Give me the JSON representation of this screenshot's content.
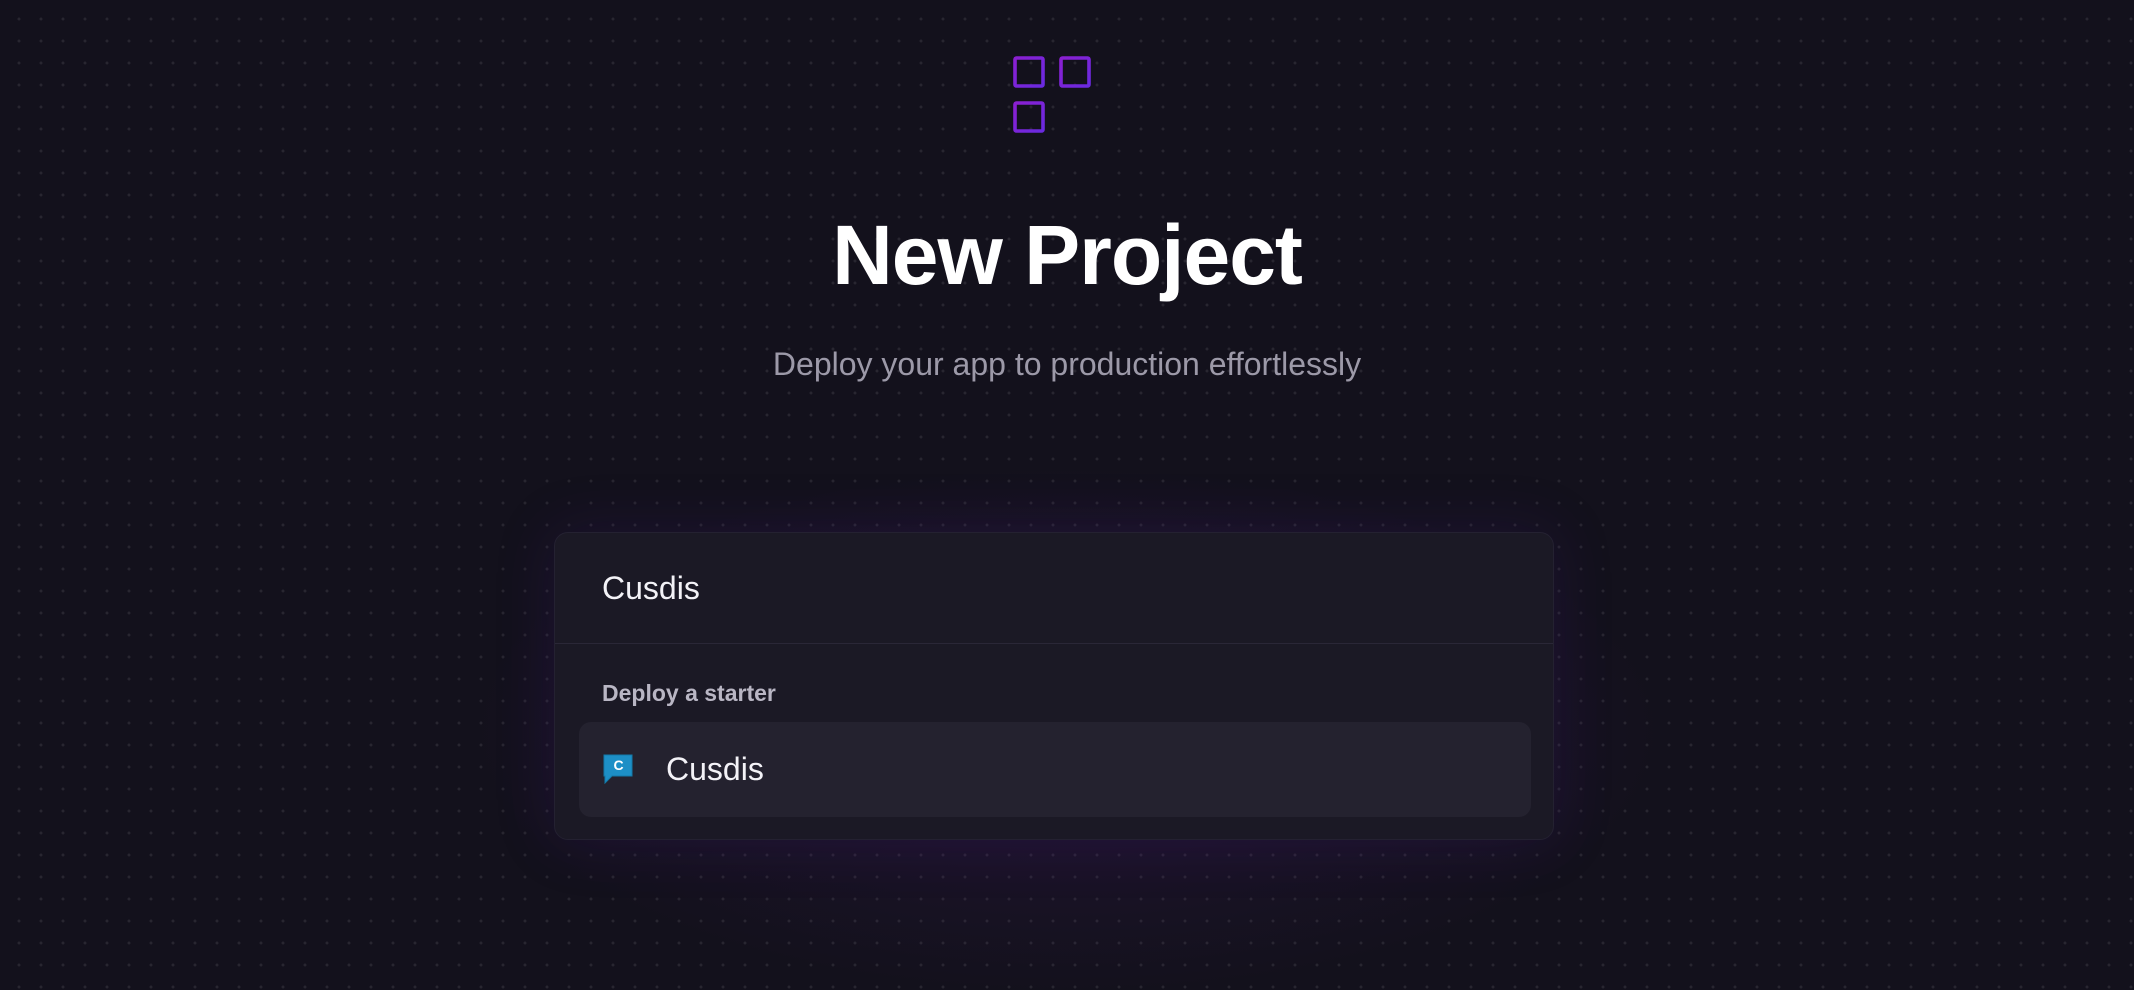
{
  "header": {
    "logo_icon": "new-project-grid-plus-icon",
    "title": "New Project",
    "subtitle": "Deploy your app to production effortlessly"
  },
  "search": {
    "value": "Cusdis"
  },
  "results": {
    "section_label": "Deploy a starter",
    "items": [
      {
        "label": "Cusdis",
        "icon": "cusdis-icon"
      }
    ]
  },
  "colors": {
    "background": "#13111c",
    "panel": "#1b1925",
    "accent_purple": "#7e22ce",
    "accent_violet": "#6d28d9",
    "cusdis_blue": "#1d8fc6"
  }
}
